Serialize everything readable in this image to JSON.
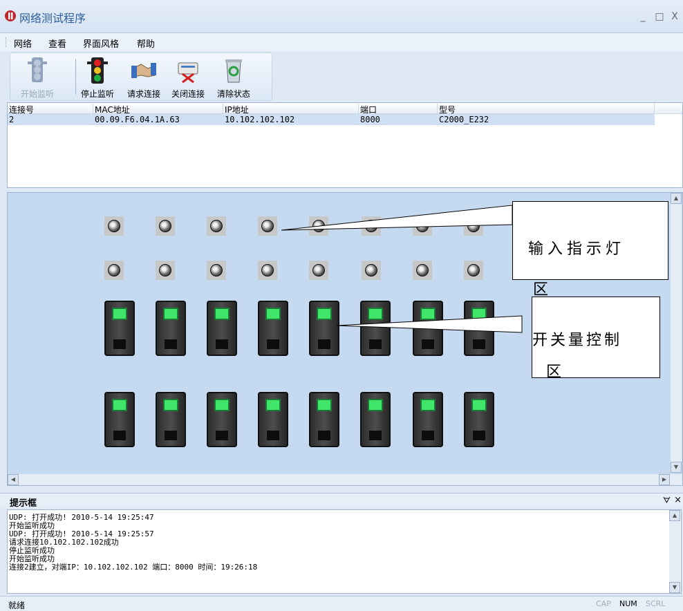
{
  "window": {
    "title": "网络测试程序",
    "minimize": "_",
    "maximize": "□",
    "close": "X"
  },
  "menu": [
    "网络",
    "查看",
    "界面风格",
    "帮助"
  ],
  "toolbar": {
    "start_label": "开始监听",
    "stop_label": "停止监听",
    "request_label": "请求连接",
    "close_label": "关闭连接",
    "clear_label": "清除状态"
  },
  "table": {
    "headers": [
      "连接号",
      "MAC地址",
      "IP地址",
      "端口",
      "型号"
    ],
    "rows": [
      [
        "2",
        "00.09.F6.04.1A.63",
        "10.102.102.102",
        "8000",
        "C2000_E232"
      ]
    ]
  },
  "callouts": {
    "input": [
      "输入指示灯",
      "区"
    ],
    "switch": [
      "开关量控制",
      "区"
    ]
  },
  "scroll": {
    "up": "▲",
    "down": "▼",
    "left": "◀",
    "right": "▶"
  },
  "panel": {
    "title": "提示框",
    "pin": "ᗊ",
    "close": "×"
  },
  "log": [
    "UDP: 打开成功!   2010-5-14 19:25:47",
    "开始监听成功",
    "UDP: 打开成功!   2010-5-14 19:25:57",
    "请求连接10.102.102.102成功",
    "停止监听成功",
    "开始监听成功",
    "连接2建立，对端IP：10.102.102.102  端口：8000  时间：19:26:18"
  ],
  "status": {
    "text": "就绪",
    "cap": "CAP",
    "num": "NUM",
    "scrl": "SCRL"
  }
}
